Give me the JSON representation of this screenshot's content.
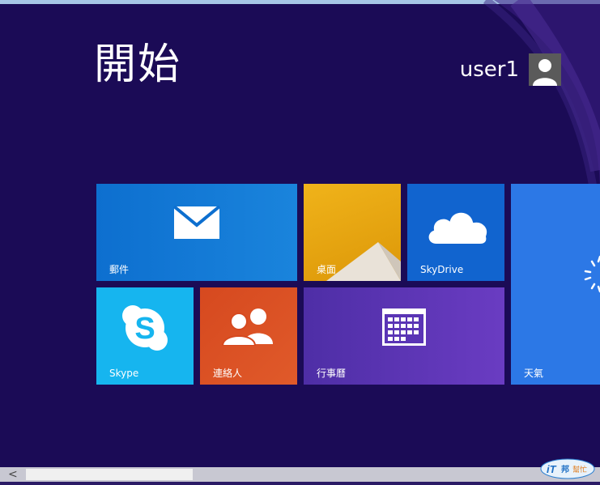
{
  "start": {
    "title": "開始"
  },
  "user": {
    "name": "user1",
    "avatar_icon": "user-avatar-icon"
  },
  "tiles": [
    {
      "id": "mail",
      "label": "郵件",
      "icon": "mail-icon",
      "color": "#0d6fcf"
    },
    {
      "id": "desktop",
      "label": "桌面",
      "icon": "desktop-wallpaper",
      "color": "#f0b31a"
    },
    {
      "id": "skydrive",
      "label": "SkyDrive",
      "icon": "cloud-icon",
      "color": "#1164cf"
    },
    {
      "id": "weather",
      "label": "天氣",
      "icon": "sun-loading-icon",
      "color": "#2c78e6"
    },
    {
      "id": "skype",
      "label": "Skype",
      "icon": "skype-icon",
      "color": "#16b5ef"
    },
    {
      "id": "contacts",
      "label": "連絡人",
      "icon": "people-icon",
      "color": "#d6491f"
    },
    {
      "id": "calendar",
      "label": "行事曆",
      "icon": "calendar-icon",
      "color": "#5a35b5"
    }
  ],
  "scrollbar": {
    "left_arrow": "<"
  },
  "colors": {
    "background": "#1b0b56",
    "scrollbar": "#c8c8d2"
  },
  "watermark": {
    "icon": "ithome-logo"
  }
}
